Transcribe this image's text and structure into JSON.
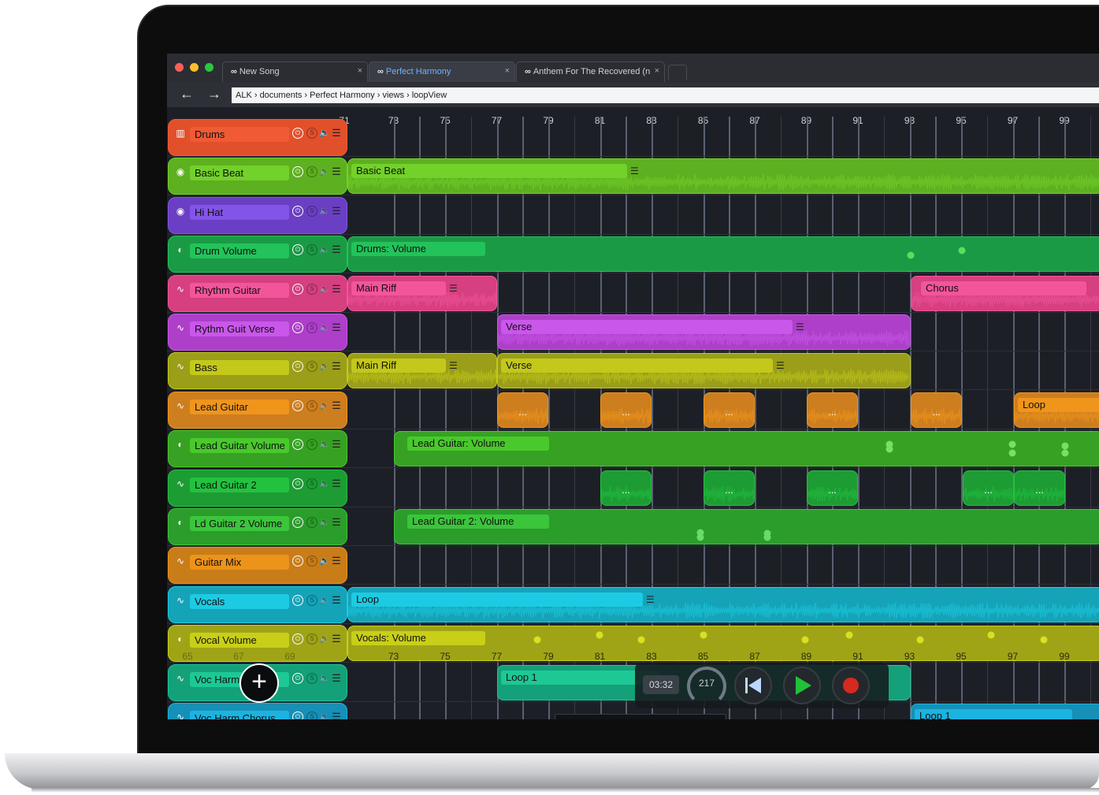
{
  "browser": {
    "tabs": [
      {
        "label": "New Song",
        "close": "×"
      },
      {
        "label": "Perfect Harmony",
        "close": "×"
      },
      {
        "label": "Anthem For The Recovered (n",
        "close": "×"
      }
    ],
    "back_icon": "arrow-left",
    "forward_icon": "arrow-right",
    "breadcrumb": "ALK  ›  documents  ›  Perfect Harmony  ›  views  ›  loopView"
  },
  "timeline": {
    "bars": [
      "71",
      "73",
      "75",
      "77",
      "79",
      "81",
      "83",
      "85",
      "87",
      "89",
      "91",
      "93",
      "95",
      "97",
      "99"
    ],
    "bars_inline": [
      "73",
      "75",
      "77",
      "79",
      "81",
      "83",
      "85",
      "87",
      "89",
      "91",
      "93",
      "95",
      "97",
      "99"
    ],
    "bars_faded": [
      "65",
      "67",
      "69"
    ]
  },
  "tracks": [
    {
      "name": "Drums",
      "color": "#e2502b",
      "label_color": "#f05a35",
      "icon": "piano-icon",
      "mute_on": true
    },
    {
      "name": "Basic Beat",
      "color": "#5db01f",
      "label_color": "#73d12b",
      "icon": "drum-icon"
    },
    {
      "name": "Hi Hat",
      "color": "#6a3fc4",
      "label_color": "#8354e8",
      "icon": "drum-icon"
    },
    {
      "name": "Drum Volume",
      "color": "#1b9a45",
      "label_color": "#22c35a",
      "icon": "knob-icon"
    },
    {
      "name": "Rhythm Guitar",
      "color": "#d63f80",
      "label_color": "#f3559a",
      "icon": "wave-icon"
    },
    {
      "name": "Rythm Guit Verse",
      "color": "#ad3fc9",
      "label_color": "#c957ea",
      "icon": "wave-icon"
    },
    {
      "name": "Bass",
      "color": "#9a9e18",
      "label_color": "#c3c81a",
      "icon": "wave-icon"
    },
    {
      "name": "Lead Guitar",
      "color": "#cd7e1e",
      "label_color": "#f0951c",
      "icon": "wave-icon"
    },
    {
      "name": "Lead Guitar Volume",
      "color": "#37a123",
      "label_color": "#49c92c",
      "icon": "knob-icon"
    },
    {
      "name": "Lead Guitar 2",
      "color": "#1d9c34",
      "label_color": "#22c23f",
      "icon": "wave-icon"
    },
    {
      "name": "Ld Guitar 2 Volume",
      "color": "#2b9d2b",
      "label_color": "#3bc53b",
      "icon": "knob-icon"
    },
    {
      "name": "Guitar Mix",
      "color": "#c97d18",
      "label_color": "#ec931a",
      "icon": "wave-icon",
      "mute_on": true
    },
    {
      "name": "Vocals",
      "color": "#15a3b8",
      "label_color": "#1ccbe3",
      "icon": "wave-icon"
    },
    {
      "name": "Vocal Volume",
      "color": "#9fa417",
      "label_color": "#c9cf18",
      "icon": "knob-icon"
    },
    {
      "name": "Voc Harm",
      "color": "#14a078",
      "label_color": "#1cc895",
      "icon": "wave-icon"
    },
    {
      "name": "Voc Harm Chorus",
      "color": "#1690b6",
      "label_color": "#1cb3e0",
      "icon": "wave-icon"
    }
  ],
  "clips": {
    "basic_beat": "Basic Beat",
    "drums_volume": "Drums: Volume",
    "main_riff": "Main Riff",
    "chorus": "Chorus",
    "verse": "Verse",
    "bass_main_riff": "Main Riff",
    "bass_verse": "Verse",
    "loop": "Loop",
    "lead_guitar_volume": "Lead Guitar: Volume",
    "lead_guitar2_volume": "Lead Guitar 2: Volume",
    "vocals_loop": "Loop",
    "vocals_volume": "Vocals: Volume",
    "loop1": "Loop 1",
    "loop1_b": "Loop 1",
    "ellipsis": "..."
  },
  "transport": {
    "time": "03:32",
    "tempo": "217",
    "rewind_icon": "skip-back-icon",
    "play_icon": "play-icon",
    "record_icon": "record-icon"
  },
  "add_button": "+"
}
